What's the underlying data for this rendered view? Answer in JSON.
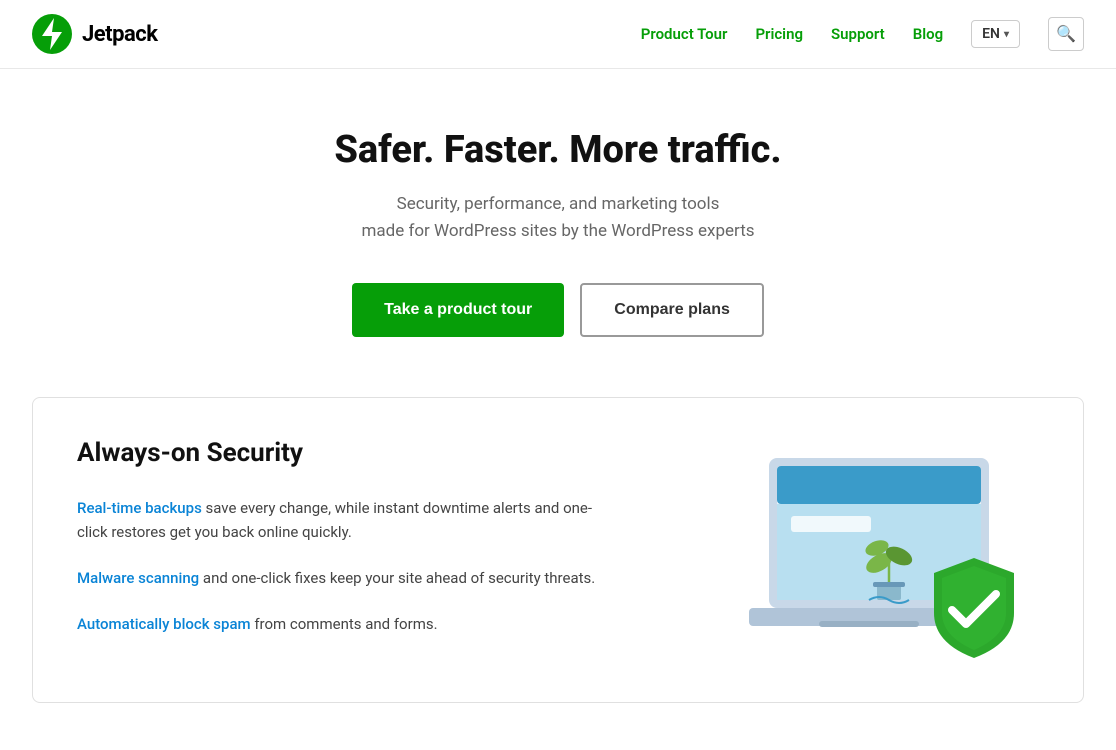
{
  "header": {
    "logo_text": "Jetpack",
    "nav": {
      "product_tour": "Product Tour",
      "pricing": "Pricing",
      "support": "Support",
      "blog": "Blog",
      "lang": "EN"
    }
  },
  "hero": {
    "title": "Safer. Faster. More traffic.",
    "subtitle_line1": "Security, performance, and marketing tools",
    "subtitle_line2": "made for WordPress sites by the WordPress experts",
    "btn_primary": "Take a product tour",
    "btn_secondary": "Compare plans"
  },
  "security_card": {
    "title": "Always-on Security",
    "paragraph1_prefix": "Real-time backups",
    "paragraph1_middle": " save every change, while instant downtime alerts and one-click restores get you back online quickly.",
    "paragraph1_link_text": "Real-time backups",
    "paragraph2_link_text": "Malware scanning",
    "paragraph2_suffix": " and one-click fixes keep your site ahead of security threats.",
    "paragraph3_link_text": "Automatically block spam",
    "paragraph3_suffix": " from comments and forms."
  },
  "colors": {
    "green": "#069e08",
    "blue_link": "#0a84d6",
    "shield_green": "#2ca82c",
    "laptop_blue_dark": "#3a9bc9",
    "laptop_blue_light": "#b8dff0",
    "laptop_frame": "#c8d8e8"
  }
}
